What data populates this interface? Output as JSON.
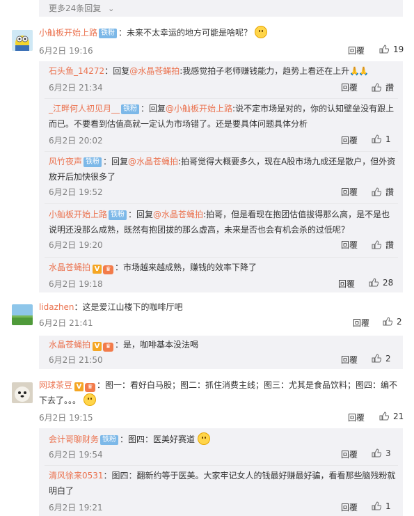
{
  "more": {
    "label": "更多24条回复",
    "icon": "chevron-down-icon"
  },
  "colors": {
    "username": "#eb7350",
    "badge": "#7cb8e8",
    "text": "#333333",
    "meta": "#808080",
    "sub_bg": "#f2f2f5"
  },
  "reply_label": "回覆",
  "comments": [
    {
      "user": "小舢板开始上路",
      "badge": "铁粉",
      "text": "：未来不太幸运的地方可能是啥呢？",
      "time": "6月2日 19:16",
      "likes": "19"
    },
    {
      "user": "石头鱼_14272",
      "sep": "：回复",
      "at": "@水晶苍蝇拍",
      "text": ":我感觉拍子老师赚钱能力，趋势上看还在上升",
      "time": "6月2日 21:34",
      "likes": "讚"
    },
    {
      "user": "_江畔何人初见月__",
      "badge": "铁粉",
      "sep": "：回复",
      "at": "@小舢板开始上路",
      "text": ":说不定市场是对的，你的认知壁垒没有跟上而已。不要看到估值高就一定认为市场错了。还是要具体问题具体分析",
      "time": "6月2日 20:02",
      "likes": "1"
    },
    {
      "user": "风竹夜声",
      "badge": "铁粉",
      "sep": "：回复",
      "at": "@水晶苍蝇拍",
      "text": ":拍哥觉得大概要多久，现在A股市场九成还是散户，但外资放开后加快很多了",
      "time": "6月2日 19:52",
      "likes": "讚"
    },
    {
      "user": "小舢板开始上路",
      "badge": "铁粉",
      "sep": "：回复",
      "at": "@水晶苍蝇拍",
      "text": ":拍哥，但是看现在抱团估值拔得那么高，是不是也说明还没那么成熟，既然有抱团拔的那么虚高，未来是否也会有机会杀的过低呢？",
      "time": "6月2日 19:20",
      "likes": "讚"
    },
    {
      "user": "水晶苍蝇拍",
      "text": "：市场越来越成熟，赚钱的效率下降了",
      "time": "6月2日 19:18",
      "likes": "28"
    },
    {
      "user": "lidazhen",
      "text": "：这是爱江山楼下的咖啡厅吧",
      "time": "6月2日 21:41",
      "likes": "2"
    },
    {
      "user": "水晶苍蝇拍",
      "text": "：是，咖啡基本没法喝",
      "time": "6月2日 21:50",
      "likes": "2"
    },
    {
      "user": "网球茶豆",
      "text": "：图一：看好白马股；图二：抓住消费主线；图三：尤其是食品饮料；图四：编不下去了。。。",
      "time": "6月2日 19:15",
      "likes": "21"
    },
    {
      "user": "会计哥聊财务",
      "badge": "铁粉",
      "text": "：图四：医美好赛道",
      "time": "6月2日 19:54",
      "likes": "3"
    },
    {
      "user": "清风徐来0531",
      "text": "：图四：翻新约等于医美。大家牢记女人的钱最好赚最好骗，看看那些脑残粉就明白了",
      "time": "6月2日 19:21",
      "likes": "1"
    }
  ]
}
